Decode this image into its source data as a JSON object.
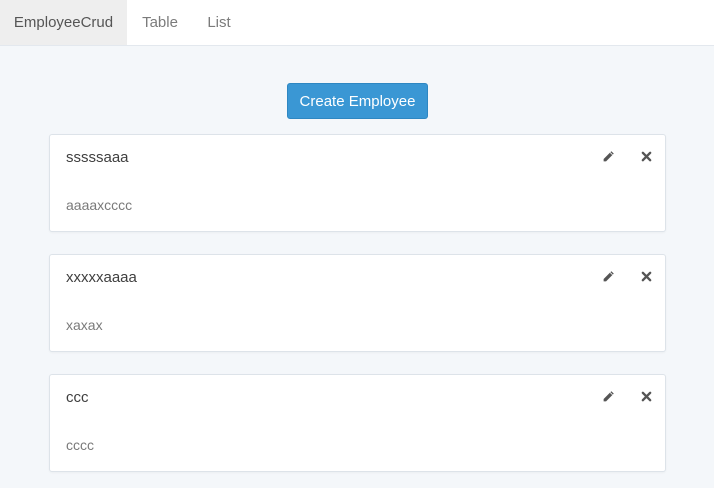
{
  "nav": {
    "brand": "EmployeeCrud",
    "items": [
      {
        "label": "Table"
      },
      {
        "label": "List"
      }
    ]
  },
  "toolbar": {
    "create_label": "Create Employee"
  },
  "employees": [
    {
      "name": "sssssaaa",
      "description": "aaaaxcccc"
    },
    {
      "name": "xxxxxaaaa",
      "description": "xaxax"
    },
    {
      "name": "ccc",
      "description": "cccc"
    }
  ],
  "icons": {
    "edit": "pencil-icon",
    "delete": "close-icon"
  },
  "colors": {
    "accent": "#3a97d4",
    "background": "#f4f7fa",
    "icon": "#555555"
  }
}
